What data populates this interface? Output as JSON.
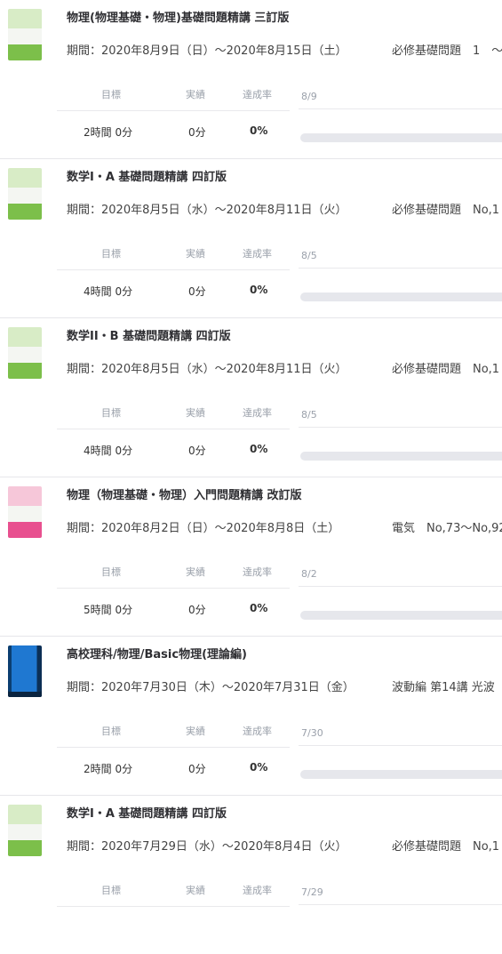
{
  "labels": {
    "goal": "目標",
    "actual": "実績",
    "rate": "達成率"
  },
  "books": [
    {
      "cover": "green",
      "title": "物理(物理基礎・物理)基礎問題精講 三訂版",
      "period": "期間：2020年8月9日（日）〜2020年8月15日（土）",
      "range": "必修基礎問題　1　〜",
      "date": "8/9",
      "goal": "2時間 0分",
      "actual": "0分",
      "rate": "0%",
      "progress": 0
    },
    {
      "cover": "green",
      "title": "数学I・A 基礎問題精講 四訂版",
      "period": "期間：2020年8月5日（水）〜2020年8月11日（火）",
      "range": "必修基礎問題　No,1",
      "date": "8/5",
      "goal": "4時間 0分",
      "actual": "0分",
      "rate": "0%",
      "progress": 0
    },
    {
      "cover": "green",
      "title": "数学II・B 基礎問題精講 四訂版",
      "period": "期間：2020年8月5日（水）〜2020年8月11日（火）",
      "range": "必修基礎問題　No,1",
      "date": "8/5",
      "goal": "4時間 0分",
      "actual": "0分",
      "rate": "0%",
      "progress": 0
    },
    {
      "cover": "pink",
      "title": "物理（物理基礎・物理）入門問題精講 改訂版",
      "period": "期間：2020年8月2日（日）〜2020年8月8日（土）",
      "range": "電気　No,73〜No,92",
      "date": "8/2",
      "goal": "5時間 0分",
      "actual": "0分",
      "rate": "0%",
      "progress": 0
    },
    {
      "cover": "blue",
      "title": "高校理科/物理/Basic物理(理論編)",
      "period": "期間：2020年7月30日（木）〜2020年7月31日（金）",
      "range": "波動編 第14講 光波",
      "date": "7/30",
      "goal": "2時間 0分",
      "actual": "0分",
      "rate": "0%",
      "progress": 0
    },
    {
      "cover": "green",
      "title": "数学I・A 基礎問題精講 四訂版",
      "period": "期間：2020年7月29日（水）〜2020年8月4日（火）",
      "range": "必修基礎問題　No,1",
      "date": "7/29",
      "goal": "",
      "actual": "",
      "rate": "",
      "progress": 0
    }
  ],
  "colors": {
    "green": "#7cbf4a",
    "pink": "#e8508f",
    "blue": "#1f78d1",
    "bar_track": "#e6e7ec",
    "bar_fill": "#4aa3ff"
  }
}
